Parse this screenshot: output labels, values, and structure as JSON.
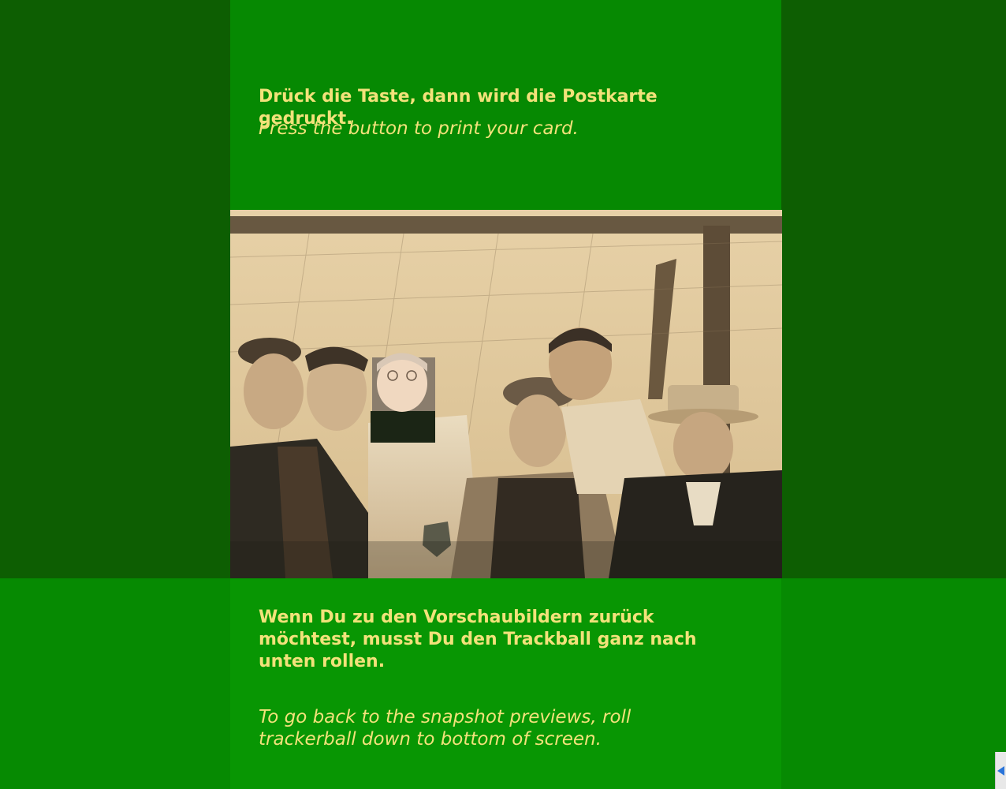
{
  "instructions": {
    "print_de": "Drück die Taste, dann wird die Postkarte gedruckt.",
    "print_en": "Press the button to print your card.",
    "back_de": "Wenn Du zu den Vorschaubildern zurück möchtest, musst Du den Trackball ganz nach unten rollen.",
    "back_en": "To go back to the snapshot previews, roll trackerball down to bottom of screen."
  },
  "photo": {
    "alt": "Vintage sepia team photograph with a face composited onto one player"
  },
  "colors": {
    "background_dark": "#0d5e02",
    "column": "#068902",
    "text": "#f2e27a"
  },
  "icons": {
    "scroll": "scroll-left-arrow-icon"
  }
}
